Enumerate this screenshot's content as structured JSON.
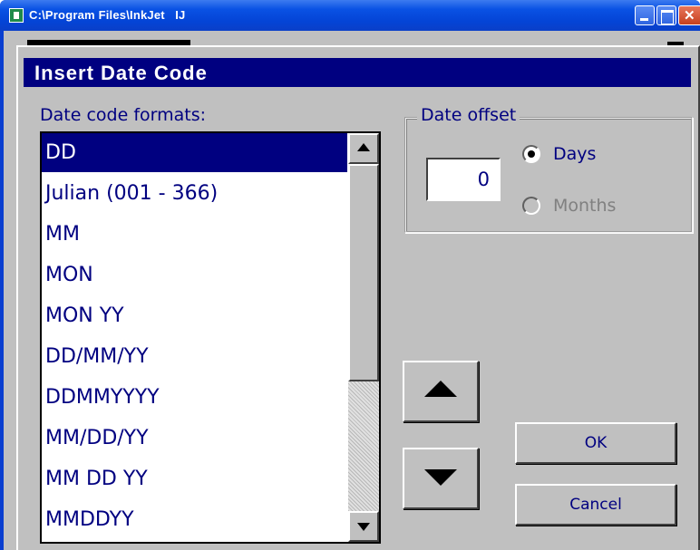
{
  "window": {
    "title": "C:\\Program Files\\InkJet   IJ"
  },
  "dialog": {
    "title": "Insert Date Code",
    "list_label": "Date code formats:",
    "formats": [
      "DD",
      "Julian (001 - 366)",
      "MM",
      "MON",
      "MON YY",
      "DD/MM/YY",
      "DDMMYYYY",
      "MM/DD/YY",
      "MM DD YY",
      "MMDDYY"
    ],
    "selected_index": 0,
    "offset_group_label": "Date offset",
    "offset_value": "0",
    "radio_days": "Days",
    "radio_months": "Months",
    "radio_selected": "Days",
    "ok_label": "OK",
    "cancel_label": "Cancel"
  },
  "colors": {
    "dialog_face": "#c0c0c0",
    "title_bar": "#000080",
    "text": "#000080",
    "disabled_text": "#808080"
  },
  "icons": [
    "app-icon",
    "minimize-icon",
    "maximize-icon",
    "close-icon",
    "scroll-up-icon",
    "scroll-down-icon",
    "move-up-arrow-icon",
    "move-down-arrow-icon"
  ]
}
